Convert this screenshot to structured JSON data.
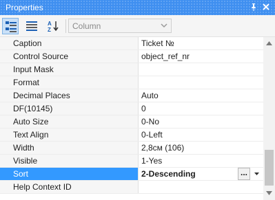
{
  "window": {
    "title": "Properties",
    "pin_icon": "pin-icon",
    "close_icon": "close-icon"
  },
  "toolbar": {
    "buttons": [
      {
        "icon": "categorized-view-icon",
        "active": true
      },
      {
        "icon": "list-view-icon",
        "active": false
      },
      {
        "icon": "sort-az-icon",
        "active": false
      }
    ],
    "object_select": {
      "value": "Column",
      "disabled": true
    }
  },
  "properties": [
    {
      "name": "Caption",
      "value": "Ticket №"
    },
    {
      "name": "Control Source",
      "value": "object_ref_nr"
    },
    {
      "name": "Input Mask",
      "value": ""
    },
    {
      "name": "Format",
      "value": ""
    },
    {
      "name": "Decimal Places",
      "value": "Auto"
    },
    {
      "name": "DF(10145)",
      "value": "0"
    },
    {
      "name": "Auto Size",
      "value": "0-No"
    },
    {
      "name": "Text Align",
      "value": "0-Left"
    },
    {
      "name": "Width",
      "value": "2,8см (106)"
    },
    {
      "name": "Visible",
      "value": "1-Yes"
    },
    {
      "name": "Sort",
      "value": "2-Descending",
      "selected": true
    },
    {
      "name": "Help Context ID",
      "value": ""
    }
  ],
  "selected_row": {
    "ellipsis_label": "...",
    "dropdown_icon": "chevron-down-icon"
  },
  "colors": {
    "titlebar": "#3f8ff0",
    "selection": "#3399ff",
    "name_column": "#f6f6f6"
  }
}
